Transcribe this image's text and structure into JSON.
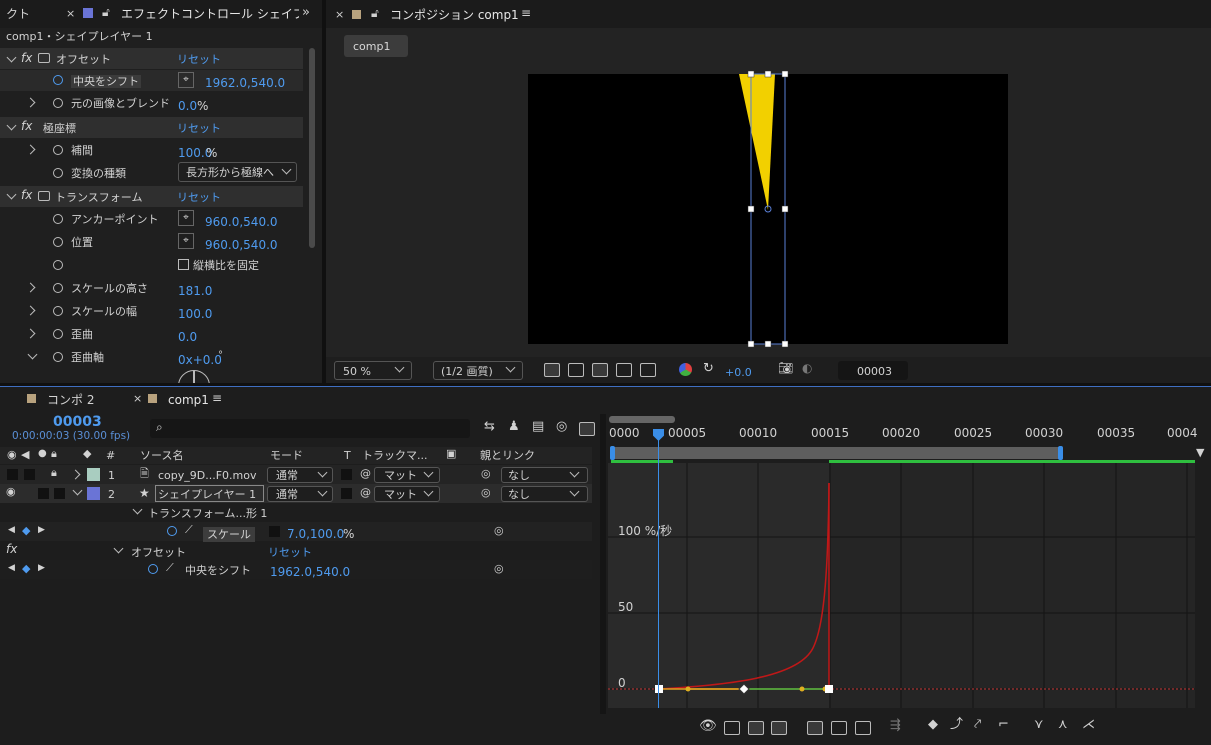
{
  "effects_panel": {
    "tab_left_label": "クト",
    "tab_label": "エフェクトコントロール シェイプ",
    "layer_label": "comp1・シェイプレイヤー 1",
    "groups": [
      {
        "name": "オフセット",
        "reset": "リセット",
        "props": [
          {
            "name": "中央をシフト",
            "value": "1962.0,540.0"
          },
          {
            "name": "元の画像とブレンド",
            "value": "0.0",
            "unit": "%"
          }
        ]
      },
      {
        "name": "極座標",
        "reset": "リセット",
        "props": [
          {
            "name": "補間",
            "value": "100.0",
            "unit": "%"
          },
          {
            "name": "変換の種類",
            "value": "長方形から極線へ"
          }
        ]
      },
      {
        "name": "トランスフォーム",
        "reset": "リセット",
        "props": [
          {
            "name": "アンカーポイント",
            "value": "960.0,540.0"
          },
          {
            "name": "位置",
            "value": "960.0,540.0"
          },
          {
            "name": "",
            "value": "縦横比を固定"
          },
          {
            "name": "スケールの高さ",
            "value": "181.0"
          },
          {
            "name": "スケールの幅",
            "value": "100.0"
          },
          {
            "name": "歪曲",
            "value": "0.0"
          },
          {
            "name": "歪曲軸",
            "value": "0x+0.0",
            "unit": "°"
          }
        ]
      }
    ]
  },
  "comp_panel": {
    "tab_label": "コンポジション comp1",
    "chip": "comp1",
    "zoom": "50 %",
    "resolution": "(1/2 画質)",
    "exposure": "+0.0",
    "timecode": "00003",
    "colors": {
      "shape": "#f2d000",
      "guide": "#5a7fd6"
    }
  },
  "timeline": {
    "tabs": [
      "コンポ 2",
      "comp1"
    ],
    "timecode": "00003",
    "timecode_sub": "0:00:00:03 (30.00 fps)",
    "search_placeholder": "",
    "columns": {
      "source": "ソース名",
      "mode": "モード",
      "t": "T",
      "track": "トラックマ...",
      "parent": "親とリンク"
    },
    "layers": [
      {
        "num": "1",
        "name": "copy_9D...F0.mov",
        "mode": "通常",
        "track": "マット",
        "parent": "なし",
        "color": "#a9cdc0"
      },
      {
        "num": "2",
        "name": "シェイプレイヤー 1",
        "mode": "通常",
        "track": "マット",
        "parent": "なし",
        "color": "#6a74d6"
      }
    ],
    "transform_row": "トランスフォーム...形 1",
    "scale_label": "スケール",
    "scale_value": "7.0,100.0",
    "scale_unit": "%",
    "fx_label": "fx",
    "offset_label": "オフセット",
    "offset_reset": "リセット",
    "shift_label": "中央をシフト",
    "shift_value": "1962.0,540.0",
    "ruler": [
      "0000",
      "00005",
      "00010",
      "00015",
      "00020",
      "00025",
      "00030",
      "00035",
      "0004"
    ],
    "graph_labels": [
      "100 %/秒",
      "50",
      "0"
    ]
  }
}
